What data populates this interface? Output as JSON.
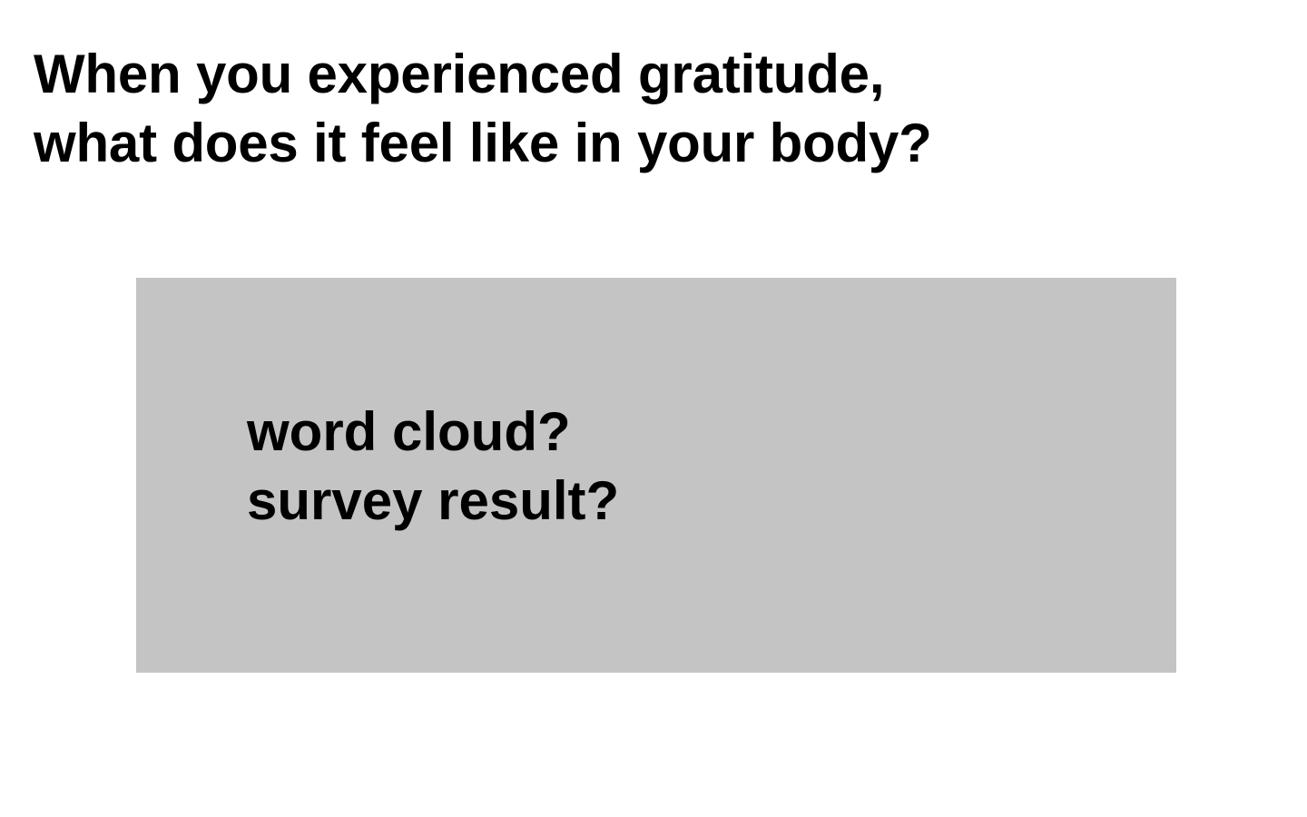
{
  "slide": {
    "title_lines": [
      "When you experienced gratitude,",
      "what does it feel like in your body?"
    ],
    "placeholder": {
      "lines": [
        "word cloud?",
        "survey result?"
      ],
      "background_color": "#c4c4c4"
    }
  }
}
